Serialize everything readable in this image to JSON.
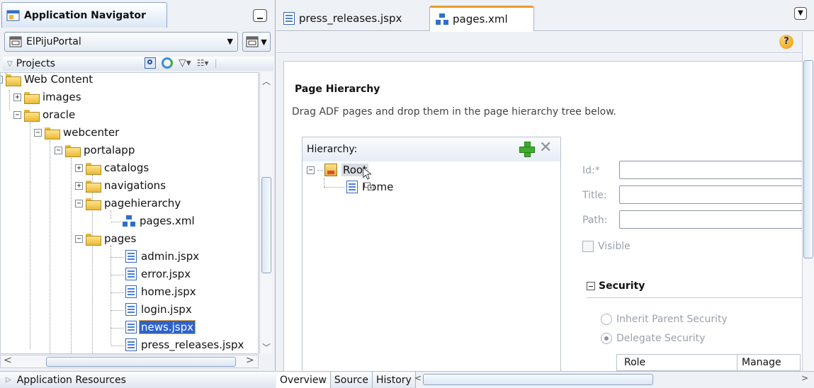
{
  "navigator": {
    "title": "Application Navigator",
    "app_name": "ElPijuPortal",
    "projects_label": "Projects",
    "app_resources": "Application Resources"
  },
  "tree": [
    {
      "label": "Web Content",
      "icon": "folder-icon",
      "expander": "minus"
    },
    {
      "label": "images",
      "icon": "folder-icon",
      "expander": "plus"
    },
    {
      "label": "oracle",
      "icon": "folder-icon",
      "expander": "minus"
    },
    {
      "label": "webcenter",
      "icon": "folder-icon",
      "expander": "minus"
    },
    {
      "label": "portalapp",
      "icon": "folder-icon",
      "expander": "minus"
    },
    {
      "label": "catalogs",
      "icon": "folder-icon",
      "expander": "plus"
    },
    {
      "label": "navigations",
      "icon": "folder-icon",
      "expander": "plus"
    },
    {
      "label": "pagehierarchy",
      "icon": "folder-icon",
      "expander": "minus"
    },
    {
      "label": "pages.xml",
      "icon": "xml-icon",
      "expander": "none"
    },
    {
      "label": "pages",
      "icon": "folder-icon",
      "expander": "minus"
    },
    {
      "label": "admin.jspx",
      "icon": "jspx-icon",
      "expander": "none"
    },
    {
      "label": "error.jspx",
      "icon": "jspx-icon",
      "expander": "none"
    },
    {
      "label": "home.jspx",
      "icon": "jspx-icon",
      "expander": "none"
    },
    {
      "label": "login.jspx",
      "icon": "jspx-icon",
      "expander": "none"
    },
    {
      "label": "news.jspx",
      "icon": "jspx-icon",
      "expander": "none",
      "selected": true
    },
    {
      "label": "press_releases.jspx",
      "icon": "jspx-icon",
      "expander": "none"
    }
  ],
  "editor": {
    "tabs": [
      {
        "label": "press_releases.jspx",
        "icon": "jspx-icon"
      },
      {
        "label": "pages.xml",
        "icon": "xml-icon",
        "active": true
      }
    ],
    "page_hierarchy_title": "Page Hierarchy",
    "description": "Drag ADF pages and drop them in the page hierarchy tree below.",
    "hierarchy_label": "Hierarchy:",
    "hierarchy_nodes": {
      "root": "Root",
      "child": "Home"
    },
    "fields": {
      "id": "Id:*",
      "title": "Title:",
      "path": "Path:"
    },
    "visible_label": "Visible",
    "security_label": "Security",
    "security_options": [
      {
        "label": "Inherit Parent Security",
        "selected": false
      },
      {
        "label": "Delegate Security",
        "selected": true
      }
    ],
    "role_table": {
      "headers": [
        "Role",
        "Manage"
      ]
    },
    "bottom_tabs": [
      "Overview",
      "Source",
      "History"
    ]
  },
  "colors": {
    "selection": "#2d62c9",
    "accent_tab": "#e79d2c",
    "add_green": "#3cae2c"
  }
}
